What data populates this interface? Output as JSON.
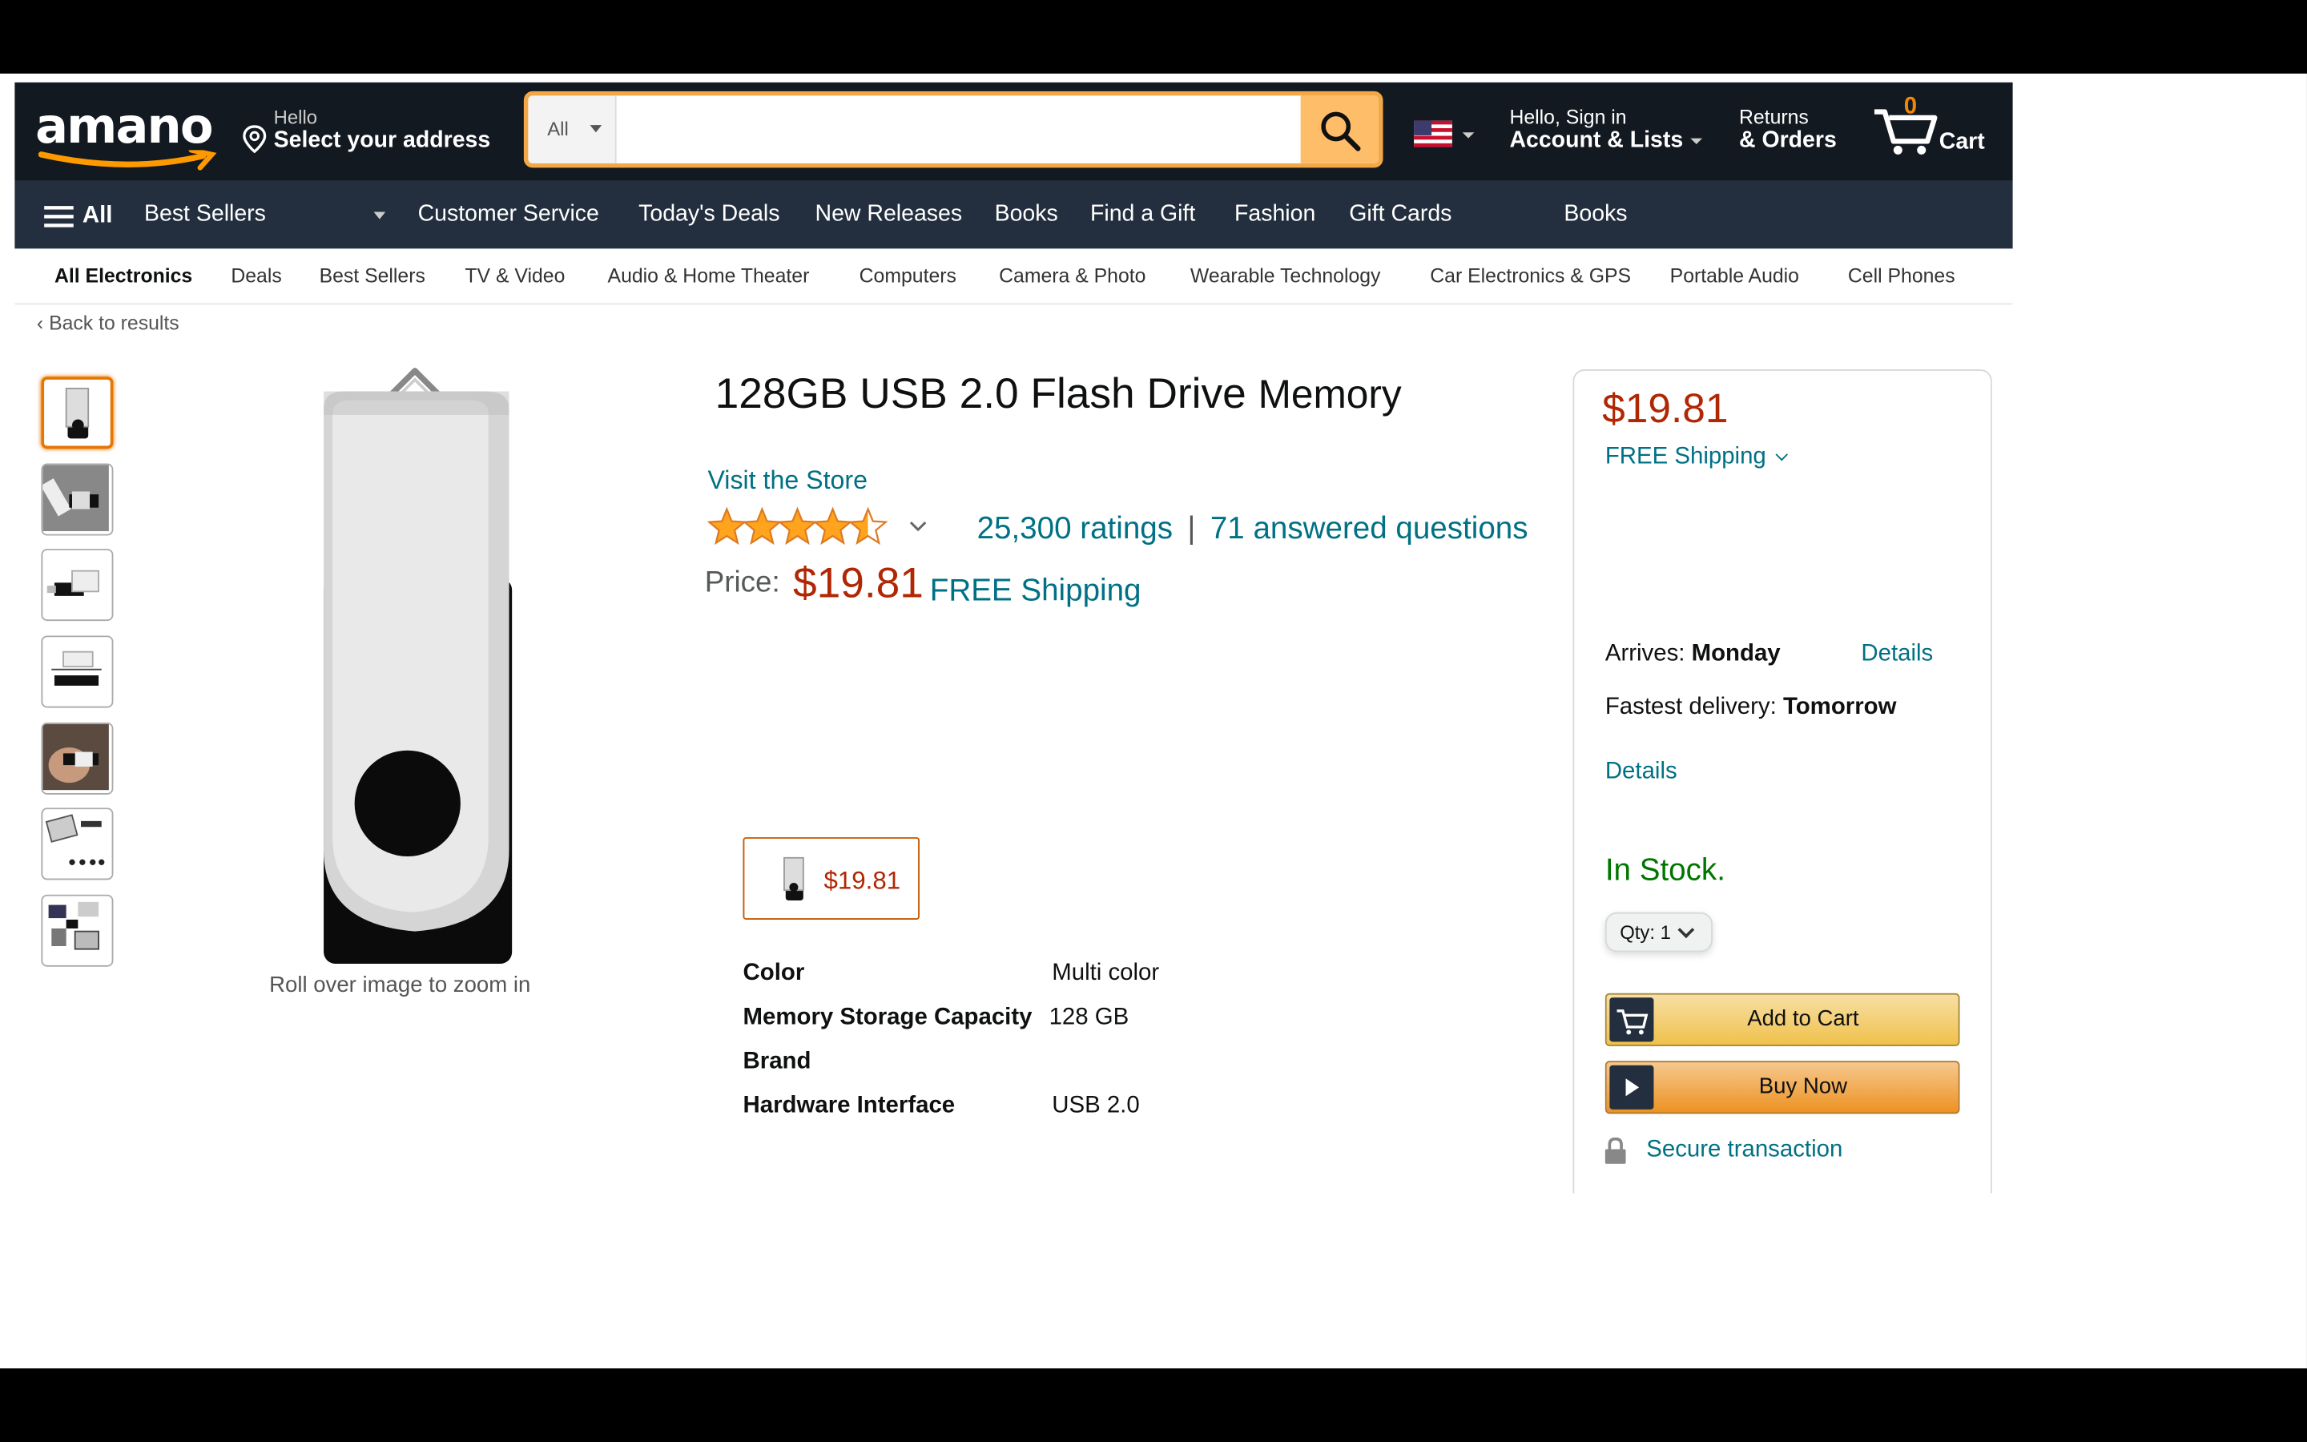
{
  "nav": {
    "logo": "amano",
    "address_hello": "Hello",
    "address_select": "Select your address",
    "search_category": "All",
    "search_placeholder": "",
    "account_hello": "Hello, Sign in",
    "account_lists": "Account & Lists",
    "returns": "Returns",
    "orders": "& Orders",
    "cart_count": "0",
    "cart_label": "Cart"
  },
  "subnav": {
    "all": "All",
    "items": [
      "Best Sellers",
      "Customer Service",
      "Today's Deals",
      "New Releases",
      "Books",
      "Find a Gift",
      "Fashion",
      "Gift Cards",
      "Books"
    ]
  },
  "categories": [
    "All Electronics",
    "Deals",
    "Best Sellers",
    "TV & Video",
    "Audio & Home Theater",
    "Computers",
    "Camera & Photo",
    "Wearable Technology",
    "Car Electronics & GPS",
    "Portable Audio",
    "Cell Phones"
  ],
  "back_to_results": "Back to results",
  "zoom_hint": "Roll over image to zoom in",
  "product": {
    "title": "128GB USB 2.0 Flash Drive",
    "title_suffix": "Memory",
    "store_link": "Visit the Store",
    "rating_stars": 4.5,
    "ratings_count": "25,300 ratings",
    "separator": "|",
    "answered_questions": "71 answered questions",
    "price_label": "Price:",
    "price": "$19.81",
    "shipping": "FREE Shipping",
    "swatch_price": "$19.81",
    "specs": [
      {
        "key": "Color",
        "value": "Multi color"
      },
      {
        "key": "Memory Storage Capacity",
        "value": "128 GB"
      },
      {
        "key": "Brand",
        "value": ""
      },
      {
        "key": "Hardware Interface",
        "value": "USB 2.0"
      }
    ]
  },
  "buybox": {
    "price": "$19.81",
    "shipping": "FREE Shipping",
    "arrives_label": "Arrives:",
    "arrives_day": "Monday",
    "details": "Details",
    "fastest_label": "Fastest delivery:",
    "fastest_day": "Tomorrow",
    "details2": "Details",
    "stock": "In Stock.",
    "qty": "Qty: 1",
    "add_to_cart": "Add to Cart",
    "buy_now": "Buy Now",
    "secure": "Secure transaction"
  },
  "colors": {
    "nav_bg": "#131921",
    "subnav_bg": "#232f3e",
    "price": "#b12704",
    "link": "#007185",
    "stock": "#007600",
    "search_btn": "#febd69"
  }
}
